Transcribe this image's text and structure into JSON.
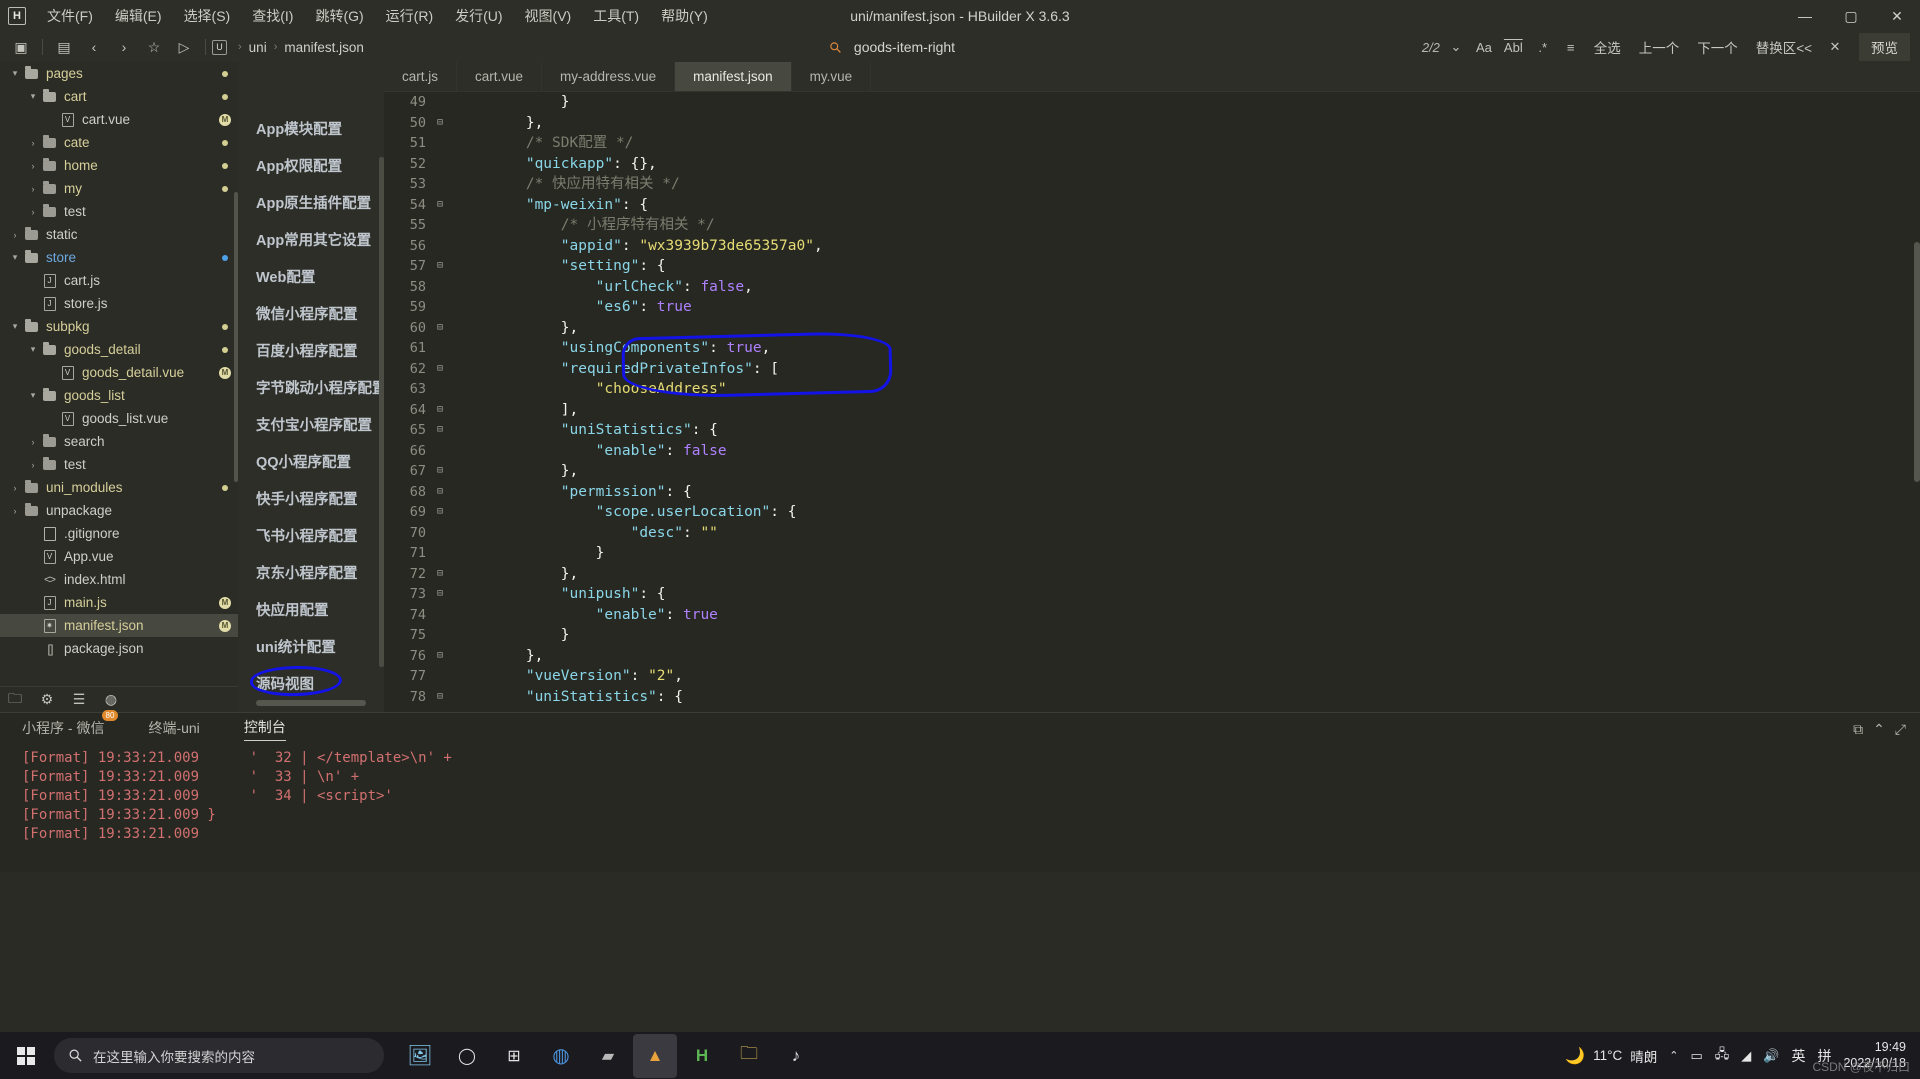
{
  "window": {
    "title": "uni/manifest.json - HBuilder X 3.6.3",
    "logo": "H",
    "minimize": "—",
    "maximize": "▢",
    "close": "✕"
  },
  "menubar": {
    "items": [
      {
        "label": "文件(F)",
        "name": "menu-file"
      },
      {
        "label": "编辑(E)",
        "name": "menu-edit"
      },
      {
        "label": "选择(S)",
        "name": "menu-select"
      },
      {
        "label": "查找(I)",
        "name": "menu-find"
      },
      {
        "label": "跳转(G)",
        "name": "menu-goto"
      },
      {
        "label": "运行(R)",
        "name": "menu-run"
      },
      {
        "label": "发行(U)",
        "name": "menu-publish"
      },
      {
        "label": "视图(V)",
        "name": "menu-view"
      },
      {
        "label": "工具(T)",
        "name": "menu-tools"
      },
      {
        "label": "帮助(Y)",
        "name": "menu-help"
      }
    ]
  },
  "toolbar": {
    "icons": [
      "▣",
      "▤",
      "‹",
      "›",
      "☆",
      "▷"
    ],
    "breadcrumb": {
      "badge": "U",
      "items": [
        "uni",
        "manifest.json"
      ],
      "separator": "›"
    },
    "find": {
      "icon": "search-icon",
      "term": "goods-item-right",
      "count": "2/2",
      "chevron": "⌄",
      "case_icon": "Aa",
      "word_icon": "Abl",
      "regex_icon": ".*",
      "list_icon": "≡",
      "select_all": "全选",
      "prev": "上一个",
      "next": "下一个",
      "replace": "替换区<<",
      "close": "✕",
      "preview": "预览"
    }
  },
  "filetree": {
    "items": [
      {
        "name": "sidebar-item-pages",
        "label": "pages",
        "indent": 1,
        "type": "folder-open",
        "color": "yellow",
        "arrow": "▾",
        "marker": "dot-yellow"
      },
      {
        "name": "sidebar-item-cart-folder",
        "label": "cart",
        "indent": 2,
        "type": "folder-open",
        "color": "yellow",
        "arrow": "▾",
        "marker": "dot-yellow"
      },
      {
        "name": "sidebar-item-cart-vue",
        "label": "cart.vue",
        "indent": 3,
        "type": "vue",
        "color": "grey",
        "arrow": "",
        "marker": "m-badge"
      },
      {
        "name": "sidebar-item-cate",
        "label": "cate",
        "indent": 2,
        "type": "folder",
        "color": "yellow",
        "arrow": "›",
        "marker": "dot-yellow"
      },
      {
        "name": "sidebar-item-home",
        "label": "home",
        "indent": 2,
        "type": "folder",
        "color": "yellow",
        "arrow": "›",
        "marker": "dot-yellow"
      },
      {
        "name": "sidebar-item-my",
        "label": "my",
        "indent": 2,
        "type": "folder",
        "color": "yellow",
        "arrow": "›",
        "marker": "dot-yellow"
      },
      {
        "name": "sidebar-item-test-pages",
        "label": "test",
        "indent": 2,
        "type": "folder",
        "color": "grey",
        "arrow": "›",
        "marker": ""
      },
      {
        "name": "sidebar-item-static",
        "label": "static",
        "indent": 1,
        "type": "folder",
        "color": "grey",
        "arrow": "›",
        "marker": ""
      },
      {
        "name": "sidebar-item-store",
        "label": "store",
        "indent": 1,
        "type": "folder-open",
        "color": "blue",
        "arrow": "▾",
        "marker": "dot-blue"
      },
      {
        "name": "sidebar-item-cart-js",
        "label": "cart.js",
        "indent": 2,
        "type": "js",
        "color": "grey",
        "arrow": "",
        "marker": ""
      },
      {
        "name": "sidebar-item-store-js",
        "label": "store.js",
        "indent": 2,
        "type": "js",
        "color": "grey",
        "arrow": "",
        "marker": ""
      },
      {
        "name": "sidebar-item-subpkg",
        "label": "subpkg",
        "indent": 1,
        "type": "folder-open",
        "color": "yellow",
        "arrow": "▾",
        "marker": "dot-yellow"
      },
      {
        "name": "sidebar-item-goods-detail",
        "label": "goods_detail",
        "indent": 2,
        "type": "folder-open",
        "color": "yellow",
        "arrow": "▾",
        "marker": "dot-yellow"
      },
      {
        "name": "sidebar-item-goods-detail-vue",
        "label": "goods_detail.vue",
        "indent": 3,
        "type": "vue",
        "color": "yellow",
        "arrow": "",
        "marker": "m-badge"
      },
      {
        "name": "sidebar-item-goods-list",
        "label": "goods_list",
        "indent": 2,
        "type": "folder-open",
        "color": "yellow",
        "arrow": "▾",
        "marker": ""
      },
      {
        "name": "sidebar-item-goods-list-vue",
        "label": "goods_list.vue",
        "indent": 3,
        "type": "vue",
        "color": "grey",
        "arrow": "",
        "marker": ""
      },
      {
        "name": "sidebar-item-search",
        "label": "search",
        "indent": 2,
        "type": "folder",
        "color": "grey",
        "arrow": "›",
        "marker": ""
      },
      {
        "name": "sidebar-item-test-subpkg",
        "label": "test",
        "indent": 2,
        "type": "folder",
        "color": "grey",
        "arrow": "›",
        "marker": ""
      },
      {
        "name": "sidebar-item-uni-modules",
        "label": "uni_modules",
        "indent": 1,
        "type": "folder",
        "color": "yellow",
        "arrow": "›",
        "marker": "dot-yellow"
      },
      {
        "name": "sidebar-item-unpackage",
        "label": "unpackage",
        "indent": 1,
        "type": "folder",
        "color": "grey",
        "arrow": "›",
        "marker": ""
      },
      {
        "name": "sidebar-item-gitignore",
        "label": ".gitignore",
        "indent": 2,
        "type": "plain",
        "color": "grey",
        "arrow": "",
        "marker": ""
      },
      {
        "name": "sidebar-item-app-vue",
        "label": "App.vue",
        "indent": 2,
        "type": "vue",
        "color": "grey",
        "arrow": "",
        "marker": ""
      },
      {
        "name": "sidebar-item-index-html",
        "label": "index.html",
        "indent": 2,
        "type": "html",
        "color": "grey",
        "arrow": "",
        "marker": ""
      },
      {
        "name": "sidebar-item-main-js",
        "label": "main.js",
        "indent": 2,
        "type": "js",
        "color": "yellow",
        "arrow": "",
        "marker": "m-badge"
      },
      {
        "name": "sidebar-item-manifest-json",
        "label": "manifest.json",
        "indent": 2,
        "type": "manifest",
        "color": "yellow",
        "arrow": "",
        "marker": "m-badge",
        "selected": true
      },
      {
        "name": "sidebar-item-package-json",
        "label": "package.json",
        "indent": 2,
        "type": "brackets",
        "color": "grey",
        "arrow": "",
        "marker": ""
      }
    ],
    "footer_icons": [
      "folder-icon",
      "debug-icon",
      "outline-icon",
      "globe-icon"
    ]
  },
  "manifest_config": {
    "items": [
      {
        "label": "App模块配置",
        "name": "config-app-module"
      },
      {
        "label": "App权限配置",
        "name": "config-app-permission"
      },
      {
        "label": "App原生插件配置",
        "name": "config-app-native-plugin"
      },
      {
        "label": "App常用其它设置",
        "name": "config-app-other"
      },
      {
        "label": "Web配置",
        "name": "config-web"
      },
      {
        "label": "微信小程序配置",
        "name": "config-weixin-miniprogram"
      },
      {
        "label": "百度小程序配置",
        "name": "config-baidu-miniprogram"
      },
      {
        "label": "字节跳动小程序配置",
        "name": "config-bytedance-miniprogram"
      },
      {
        "label": "支付宝小程序配置",
        "name": "config-alipay-miniprogram"
      },
      {
        "label": "QQ小程序配置",
        "name": "config-qq-miniprogram"
      },
      {
        "label": "快手小程序配置",
        "name": "config-kuaishou-miniprogram"
      },
      {
        "label": "飞书小程序配置",
        "name": "config-feishu-miniprogram"
      },
      {
        "label": "京东小程序配置",
        "name": "config-jd-miniprogram"
      },
      {
        "label": "快应用配置",
        "name": "config-quickapp"
      },
      {
        "label": "uni统计配置",
        "name": "config-uni-statistics"
      },
      {
        "label": "源码视图",
        "name": "config-source-view"
      }
    ],
    "annotation_color": "#1313e8"
  },
  "editor": {
    "tabs": [
      {
        "label": "cart.js",
        "name": "tab-cart-js",
        "active": false
      },
      {
        "label": "cart.vue",
        "name": "tab-cart-vue",
        "active": false
      },
      {
        "label": "my-address.vue",
        "name": "tab-my-address-vue",
        "active": false
      },
      {
        "label": "manifest.json",
        "name": "tab-manifest-json",
        "active": true
      },
      {
        "label": "my.vue",
        "name": "tab-my-vue",
        "active": false
      }
    ],
    "lines": [
      {
        "no": "49",
        "fold": "",
        "tokens": [
          {
            "t": "            }",
            "c": "k-pun"
          }
        ]
      },
      {
        "no": "50",
        "fold": "⊟",
        "tokens": [
          {
            "t": "        },",
            "c": "k-pun"
          }
        ]
      },
      {
        "no": "51",
        "fold": "",
        "tokens": [
          {
            "t": "        /* SDK配置 */",
            "c": "k-cmt"
          }
        ]
      },
      {
        "no": "52",
        "fold": "",
        "tokens": [
          {
            "t": "        \"quickapp\"",
            "c": "k-key"
          },
          {
            "t": ": {},",
            "c": "k-pun"
          }
        ]
      },
      {
        "no": "53",
        "fold": "",
        "tokens": [
          {
            "t": "        /* 快应用特有相关 */",
            "c": "k-cmt"
          }
        ]
      },
      {
        "no": "54",
        "fold": "⊟",
        "tokens": [
          {
            "t": "        \"mp-weixin\"",
            "c": "k-key"
          },
          {
            "t": ": {",
            "c": "k-pun"
          }
        ]
      },
      {
        "no": "55",
        "fold": "",
        "tokens": [
          {
            "t": "            /* 小程序特有相关 */",
            "c": "k-cmt"
          }
        ]
      },
      {
        "no": "56",
        "fold": "",
        "tokens": [
          {
            "t": "            \"appid\"",
            "c": "k-key"
          },
          {
            "t": ": ",
            "c": "k-pun"
          },
          {
            "t": "\"wx3939b73de65357a0\"",
            "c": "k-str"
          },
          {
            "t": ",",
            "c": "k-pun"
          }
        ]
      },
      {
        "no": "57",
        "fold": "⊟",
        "tokens": [
          {
            "t": "            \"setting\"",
            "c": "k-key"
          },
          {
            "t": ": {",
            "c": "k-pun"
          }
        ]
      },
      {
        "no": "58",
        "fold": "",
        "tokens": [
          {
            "t": "                \"urlCheck\"",
            "c": "k-key"
          },
          {
            "t": ": ",
            "c": "k-pun"
          },
          {
            "t": "false",
            "c": "k-val"
          },
          {
            "t": ",",
            "c": "k-pun"
          }
        ]
      },
      {
        "no": "59",
        "fold": "",
        "tokens": [
          {
            "t": "                \"es6\"",
            "c": "k-key"
          },
          {
            "t": ": ",
            "c": "k-pun"
          },
          {
            "t": "true",
            "c": "k-val"
          }
        ]
      },
      {
        "no": "60",
        "fold": "⊟",
        "tokens": [
          {
            "t": "            },",
            "c": "k-pun"
          }
        ]
      },
      {
        "no": "61",
        "fold": "",
        "tokens": [
          {
            "t": "            \"usingComponents\"",
            "c": "k-key"
          },
          {
            "t": ": ",
            "c": "k-pun"
          },
          {
            "t": "true",
            "c": "k-val"
          },
          {
            "t": ",",
            "c": "k-pun"
          }
        ]
      },
      {
        "no": "62",
        "fold": "⊟",
        "tokens": [
          {
            "t": "            \"requiredPrivateInfos\"",
            "c": "k-key"
          },
          {
            "t": ": [",
            "c": "k-pun"
          }
        ]
      },
      {
        "no": "63",
        "fold": "",
        "tokens": [
          {
            "t": "                ",
            "c": "k-pun"
          },
          {
            "t": "\"chooseAddress\"",
            "c": "k-str"
          }
        ]
      },
      {
        "no": "64",
        "fold": "⊟",
        "tokens": [
          {
            "t": "            ],",
            "c": "k-pun"
          }
        ]
      },
      {
        "no": "65",
        "fold": "⊟",
        "tokens": [
          {
            "t": "            \"uniStatistics\"",
            "c": "k-key"
          },
          {
            "t": ": {",
            "c": "k-pun"
          }
        ]
      },
      {
        "no": "66",
        "fold": "",
        "tokens": [
          {
            "t": "                \"enable\"",
            "c": "k-key"
          },
          {
            "t": ": ",
            "c": "k-pun"
          },
          {
            "t": "false",
            "c": "k-val"
          }
        ]
      },
      {
        "no": "67",
        "fold": "⊟",
        "tokens": [
          {
            "t": "            },",
            "c": "k-pun"
          }
        ]
      },
      {
        "no": "68",
        "fold": "⊟",
        "tokens": [
          {
            "t": "            \"permission\"",
            "c": "k-key"
          },
          {
            "t": ": {",
            "c": "k-pun"
          }
        ]
      },
      {
        "no": "69",
        "fold": "⊟",
        "tokens": [
          {
            "t": "                \"scope.userLocation\"",
            "c": "k-key"
          },
          {
            "t": ": {",
            "c": "k-pun"
          }
        ]
      },
      {
        "no": "70",
        "fold": "",
        "tokens": [
          {
            "t": "                    \"desc\"",
            "c": "k-key"
          },
          {
            "t": ": ",
            "c": "k-pun"
          },
          {
            "t": "\"\"",
            "c": "k-str"
          }
        ]
      },
      {
        "no": "71",
        "fold": "",
        "tokens": [
          {
            "t": "                }",
            "c": "k-pun"
          }
        ]
      },
      {
        "no": "72",
        "fold": "⊟",
        "tokens": [
          {
            "t": "            },",
            "c": "k-pun"
          }
        ]
      },
      {
        "no": "73",
        "fold": "⊟",
        "tokens": [
          {
            "t": "            \"unipush\"",
            "c": "k-key"
          },
          {
            "t": ": {",
            "c": "k-pun"
          }
        ]
      },
      {
        "no": "74",
        "fold": "",
        "tokens": [
          {
            "t": "                \"enable\"",
            "c": "k-key"
          },
          {
            "t": ": ",
            "c": "k-pun"
          },
          {
            "t": "true",
            "c": "k-val"
          }
        ]
      },
      {
        "no": "75",
        "fold": "",
        "tokens": [
          {
            "t": "            }",
            "c": "k-pun"
          }
        ]
      },
      {
        "no": "76",
        "fold": "⊟",
        "tokens": [
          {
            "t": "        },",
            "c": "k-pun"
          }
        ]
      },
      {
        "no": "77",
        "fold": "",
        "tokens": [
          {
            "t": "        \"vueVersion\"",
            "c": "k-key"
          },
          {
            "t": ": ",
            "c": "k-pun"
          },
          {
            "t": "\"2\"",
            "c": "k-str"
          },
          {
            "t": ",",
            "c": "k-pun"
          }
        ]
      },
      {
        "no": "78",
        "fold": "⊟",
        "tokens": [
          {
            "t": "        \"uniStatistics\"",
            "c": "k-key"
          },
          {
            "t": ": {",
            "c": "k-pun"
          }
        ]
      }
    ]
  },
  "console": {
    "tabs": [
      {
        "label": "小程序 - 微信",
        "name": "console-tab-miniprogram",
        "badge": "80",
        "active": false
      },
      {
        "label": "终端-uni",
        "name": "console-tab-terminal",
        "badge": "",
        "active": false
      },
      {
        "label": "控制台",
        "name": "console-tab-console",
        "badge": "",
        "active": true
      }
    ],
    "controls": [
      "export-icon",
      "collapse-icon",
      "expand-icon"
    ],
    "lines": [
      "[Format] 19:33:21.009      '  32 | </template>\\n' +",
      "[Format] 19:33:21.009      '  33 | \\n' +",
      "[Format] 19:33:21.009      '  34 | <script>'",
      "[Format] 19:33:21.009 }",
      "[Format] 19:33:21.009"
    ]
  },
  "taskbar": {
    "search_placeholder": "在这里输入你要搜索的内容",
    "apps": [
      {
        "name": "taskview-icon",
        "glyph": "◉"
      },
      {
        "name": "widgets-icon",
        "glyph": "▤"
      },
      {
        "name": "chrome-icon",
        "glyph": "◍"
      },
      {
        "name": "terminal-icon",
        "glyph": "▰"
      },
      {
        "name": "hbuilder-folder-icon",
        "glyph": "▲"
      },
      {
        "name": "hbuilderx-icon",
        "glyph": "H"
      },
      {
        "name": "explorer-icon",
        "glyph": "▤"
      },
      {
        "name": "tiktok-icon",
        "glyph": "♪"
      }
    ],
    "weather_icon": "moon-icon",
    "weather_temp": "11°C",
    "weather_desc": "晴朗",
    "tray_icons": [
      "chevron-up-icon",
      "battery-icon",
      "network-icon",
      "wifi-icon",
      "volume-icon"
    ],
    "ime": "英",
    "ime2": "拼",
    "time": "19:49",
    "date": "2022/10/18",
    "watermark": "CSDN @夜不归口"
  }
}
